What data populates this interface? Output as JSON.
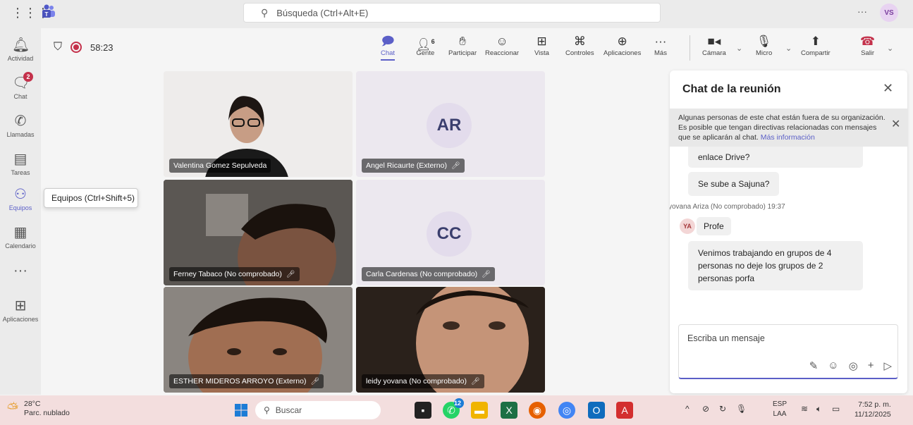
{
  "topbar": {
    "search_placeholder": "Búsqueda (Ctrl+Alt+E)",
    "more": "···",
    "avatar_initials": "VS"
  },
  "rail": {
    "items": [
      {
        "label": "Actividad",
        "icon": "bell-icon",
        "glyph": "🔔︎"
      },
      {
        "label": "Chat",
        "icon": "chat-icon",
        "glyph": "🗨︎",
        "badge": "2"
      },
      {
        "label": "Llamadas",
        "icon": "phone-icon",
        "glyph": "✆"
      },
      {
        "label": "Tareas",
        "icon": "tasks-icon",
        "glyph": "▤"
      },
      {
        "label": "Equipos",
        "icon": "teams-icon",
        "glyph": "⚇"
      },
      {
        "label": "Calendario",
        "icon": "calendar-icon",
        "glyph": "▦"
      },
      {
        "label": "",
        "icon": "more-icon",
        "glyph": "···"
      },
      {
        "label": "Aplicaciones",
        "icon": "apps-plus-icon",
        "glyph": "⊞"
      }
    ],
    "tooltip": "Equipos (Ctrl+Shift+5)"
  },
  "meeting": {
    "timer": "58:23",
    "tools": {
      "chat": "Chat",
      "people": "Gente",
      "people_count": "6",
      "raise": "Participar",
      "react": "Reaccionar",
      "view": "Vista",
      "controls": "Controles",
      "apps": "Aplicaciones",
      "more": "Más",
      "camera": "Cámara",
      "mic": "Micro",
      "share": "Compartir",
      "leave": "Salir"
    }
  },
  "participants": [
    {
      "name": "Valentina Gomez Sepulveda",
      "muted": false
    },
    {
      "name": "Angel Ricaurte (Externo)",
      "muted": true,
      "initials": "AR"
    },
    {
      "name": "Ferney Tabaco (No comprobado)",
      "muted": true
    },
    {
      "name": "Carla Cardenas (No comprobado)",
      "muted": true,
      "initials": "CC"
    },
    {
      "name": "ESTHER MIDEROS ARROYO (Externo)",
      "muted": true
    },
    {
      "name": "leidy yovana (No comprobado)",
      "muted": true
    }
  ],
  "chat": {
    "title": "Chat de la reunión",
    "banner_text": "Algunas personas de este chat están fuera de su organización. Es posible que tengan directivas relacionadas con mensajes que se aplicarán al chat.",
    "banner_link": "Más información",
    "messages": [
      {
        "text": "enlace Drive?"
      },
      {
        "text": "Se sube a Sajuna?"
      }
    ],
    "sender_meta": "yovana Ariza (No comprobado)  19:37",
    "sender_initials": "YA",
    "sender_messages": [
      {
        "text": "Profe"
      },
      {
        "text": "Venimos trabajando en grupos de 4 personas no deje los grupos de 2 personas porfa"
      }
    ],
    "composer_placeholder": "Escriba un mensaje"
  },
  "taskbar": {
    "weather_temp": "28°C",
    "weather_desc": "Parc. nublado",
    "search_label": "Buscar",
    "lang_top": "ESP",
    "lang_bottom": "LAA",
    "time": "7:52 p. m.",
    "date": "11/12/2025",
    "whatsapp_badge": "12"
  }
}
